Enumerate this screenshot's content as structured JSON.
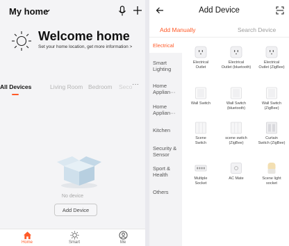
{
  "home": {
    "title": "My home",
    "welcome_title": "Welcome home",
    "welcome_subtitle": "Set your home location, get more information >",
    "tabs": [
      {
        "label": "All Devices",
        "active": true
      },
      {
        "label": "Living Room"
      },
      {
        "label": "Bedroom"
      },
      {
        "label": "Seco"
      }
    ],
    "more": "···",
    "empty_text": "No device",
    "add_button": "Add Device",
    "nav": [
      {
        "label": "Home",
        "icon": "home-icon",
        "active": true
      },
      {
        "label": "Smart",
        "icon": "sun-icon"
      },
      {
        "label": "Me",
        "icon": "user-icon"
      }
    ],
    "accent": "#ff5a28"
  },
  "add_device": {
    "title": "Add Device",
    "tabs": [
      {
        "label": "Add Manually",
        "active": true
      },
      {
        "label": "Search Device"
      }
    ],
    "categories": [
      {
        "label": "Electrical",
        "active": true
      },
      {
        "label": "Smart Lighting"
      },
      {
        "label": "Home Applian···"
      },
      {
        "label": "Home Applian···"
      },
      {
        "label": "Kitchen"
      },
      {
        "label": "Security & Sensor"
      },
      {
        "label": "Sport & Health"
      },
      {
        "label": "Others"
      }
    ],
    "devices": [
      {
        "name": "Electrical",
        "sub": "Outlet",
        "icon": "outlet-icon"
      },
      {
        "name": "Electrical",
        "sub": "Outlet (bluetooth)",
        "icon": "outlet-icon"
      },
      {
        "name": "Electrical",
        "sub": "Outlet (ZigBee)",
        "icon": "outlet-icon"
      },
      {
        "name": "Wall Switch",
        "sub": "",
        "icon": "wall-switch-icon"
      },
      {
        "name": "Wall Switch",
        "sub": "(bluetooth)",
        "icon": "wall-switch-icon"
      },
      {
        "name": "Wall Switch",
        "sub": "(ZigBee)",
        "icon": "wall-switch-icon"
      },
      {
        "name": "Scene",
        "sub": "Switch",
        "icon": "scene-switch-icon"
      },
      {
        "name": "scene switch",
        "sub": "(ZigBee)",
        "icon": "scene-switch-icon"
      },
      {
        "name": "Curtain",
        "sub": "Switch (ZigBee)",
        "icon": "curtain-switch-icon"
      },
      {
        "name": "Multiple",
        "sub": "Socket",
        "icon": "multiple-socket-icon"
      },
      {
        "name": "AC Mate",
        "sub": "",
        "icon": "ac-mate-icon"
      },
      {
        "name": "Scene light",
        "sub": "socket",
        "icon": "scene-light-socket-icon"
      }
    ]
  }
}
